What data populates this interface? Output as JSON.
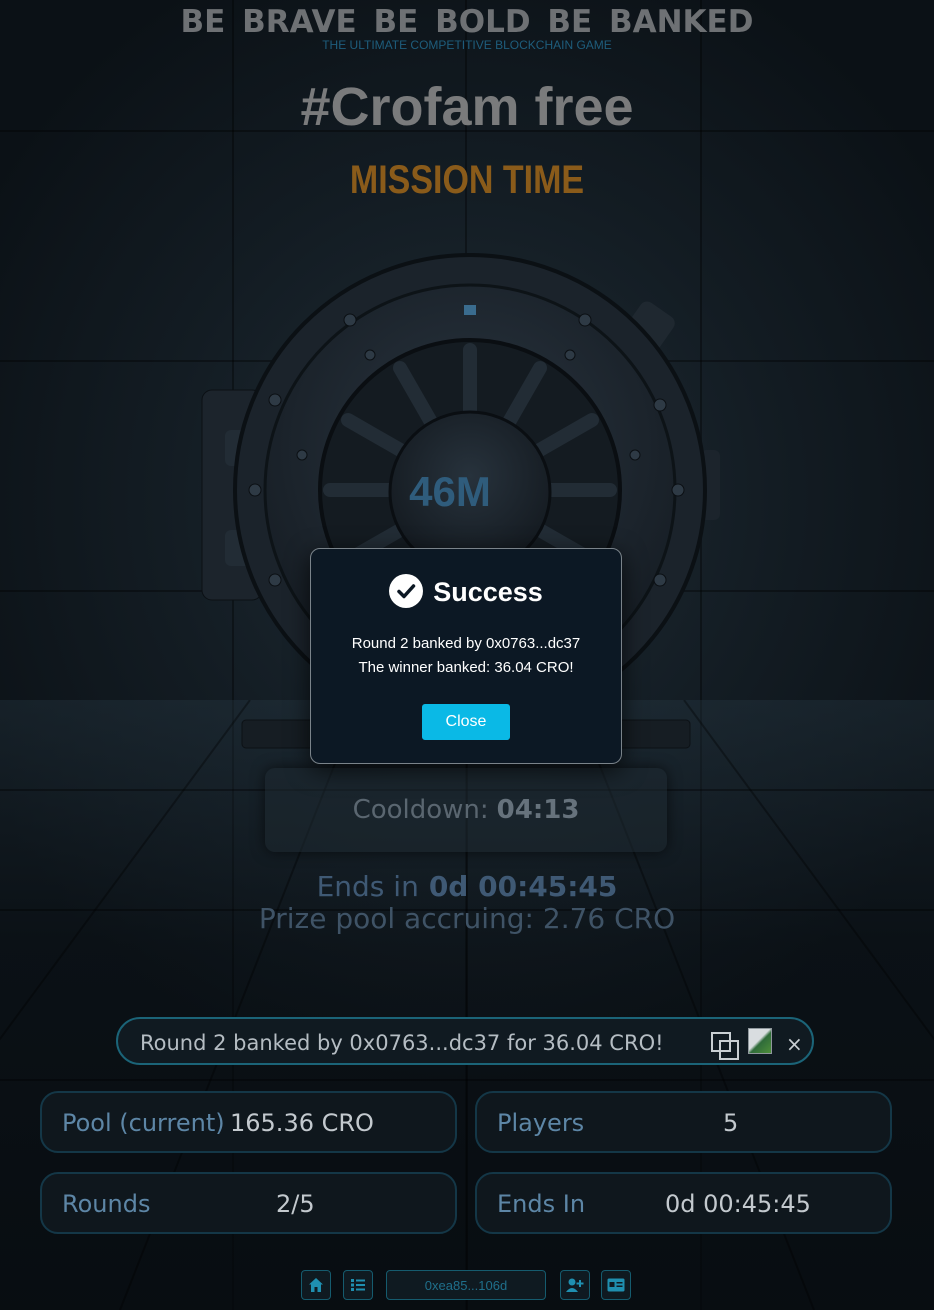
{
  "header": {
    "tagline": "BE BRAVE  BE BOLD  BE BANKED",
    "subtitle": "THE ULTIMATE COMPETITIVE BLOCKCHAIN GAME",
    "game_title": "#Crofam free",
    "mission": "MISSION TIME"
  },
  "vault": {
    "counter": "46M"
  },
  "cooldown": {
    "label": "Cooldown:",
    "value": "04:13"
  },
  "ends": {
    "label": "Ends in",
    "value": "0d 00:45:45"
  },
  "prize": {
    "text": "Prize pool accruing: 2.76 CRO"
  },
  "ticker": {
    "text": "Round 2 banked by 0x0763...dc37 for 36.04 CRO!",
    "close": "×"
  },
  "stats": {
    "pool_label": "Pool (current)",
    "pool_value": "165.36 CRO",
    "players_label": "Players",
    "players_value": "5",
    "rounds_label": "Rounds",
    "rounds_value": "2/5",
    "ends_label": "Ends In",
    "ends_value": "0d 00:45:45"
  },
  "nav": {
    "wallet": "0xea85...106d",
    "icons": [
      "home-icon",
      "list-icon",
      "add-user-icon",
      "id-card-icon"
    ]
  },
  "modal": {
    "title": "Success",
    "line1": "Round 2 banked by 0x0763...dc37",
    "line2": "The winner banked: 36.04 CRO!",
    "close_label": "Close"
  },
  "colors": {
    "accent": "#0ab9e6",
    "mission": "#8a5b1a",
    "counter": "#2f5c7c",
    "border": "#1b6478"
  }
}
